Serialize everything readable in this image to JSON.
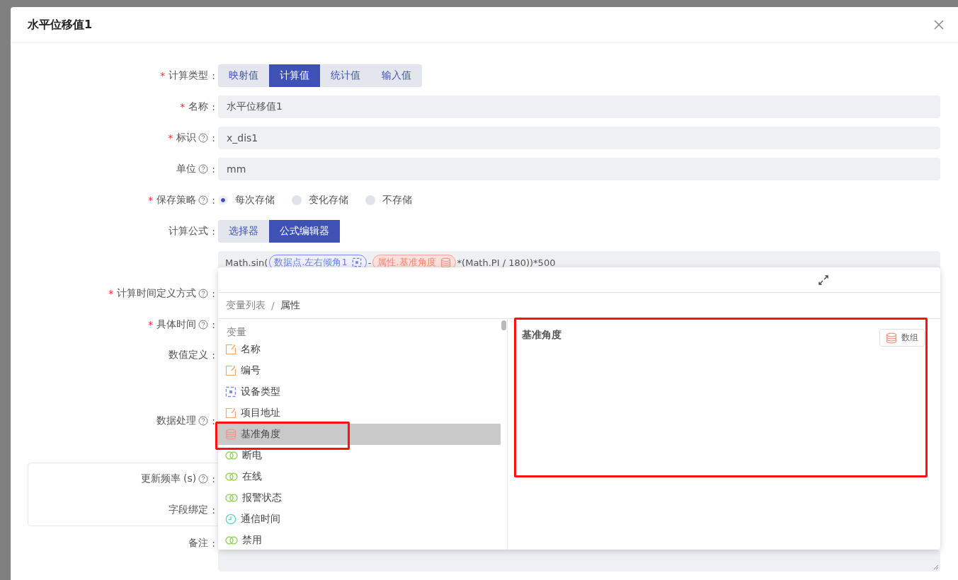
{
  "dialog": {
    "title": "水平位移值1"
  },
  "required_mark": "*",
  "label_suffix": ":",
  "calc_type": {
    "label": "计算类型",
    "required": true,
    "options": [
      {
        "label": "映射值",
        "selected": false
      },
      {
        "label": "计算值",
        "selected": true
      },
      {
        "label": "统计值",
        "selected": false
      },
      {
        "label": "输入值",
        "selected": false
      }
    ]
  },
  "fields": [
    {
      "label": "名称",
      "required": true,
      "help": false,
      "value": "水平位移值1"
    },
    {
      "label": "标识",
      "required": true,
      "help": true,
      "value": "x_dis1"
    },
    {
      "label": "单位",
      "required": false,
      "help": true,
      "value": "mm"
    }
  ],
  "save_policy": {
    "label": "保存策略",
    "required": true,
    "help": true,
    "options": [
      {
        "label": "每次存储",
        "selected": true
      },
      {
        "label": "变化存储",
        "selected": false
      },
      {
        "label": "不存储",
        "selected": false
      }
    ]
  },
  "formula": {
    "label": "计算公式",
    "required": false,
    "modes": [
      {
        "label": "选择器",
        "selected": false
      },
      {
        "label": "公式编辑器",
        "selected": true
      }
    ],
    "tokens": [
      {
        "kind": "text",
        "text": "Math.sin("
      },
      {
        "kind": "datapoint",
        "text": "数据点.左右倾角1"
      },
      {
        "kind": "text",
        "text": "-"
      },
      {
        "kind": "attribute",
        "text": "属性.基准角度"
      },
      {
        "kind": "text",
        "text": "*(Math.PI / 180))*500"
      }
    ]
  },
  "lower_fields": [
    {
      "label": "计算时间定义方式",
      "required": true,
      "help": true
    },
    {
      "label": "具体时间",
      "required": true,
      "help": true
    },
    {
      "label": "数值定义",
      "required": false,
      "help": false
    },
    {
      "label": "数据处理",
      "required": false,
      "help": true
    }
  ],
  "sub_panel": [
    {
      "label": "更新频率 (s)",
      "help": true
    },
    {
      "label": "字段绑定",
      "help": false
    }
  ],
  "remark": {
    "label": "备注"
  },
  "picker": {
    "breadcrumb_separator": "/",
    "breadcrumb": [
      {
        "label": "变量列表",
        "selected": false
      },
      {
        "label": "属性",
        "selected": true
      }
    ],
    "group": "变量",
    "items": [
      {
        "label": "名称",
        "kind": "string",
        "selected": false
      },
      {
        "label": "编号",
        "kind": "string",
        "selected": false
      },
      {
        "label": "设备类型",
        "kind": "device",
        "selected": false
      },
      {
        "label": "项目地址",
        "kind": "string",
        "selected": false
      },
      {
        "label": "基准角度",
        "kind": "array",
        "selected": true
      },
      {
        "label": "断电",
        "kind": "bool",
        "selected": false
      },
      {
        "label": "在线",
        "kind": "bool",
        "selected": false
      },
      {
        "label": "报警状态",
        "kind": "bool",
        "selected": false
      },
      {
        "label": "通信时间",
        "kind": "time",
        "selected": false
      },
      {
        "label": "禁用",
        "kind": "bool",
        "selected": false
      }
    ],
    "detail": {
      "title": "基准角度",
      "tag": "数组"
    }
  }
}
